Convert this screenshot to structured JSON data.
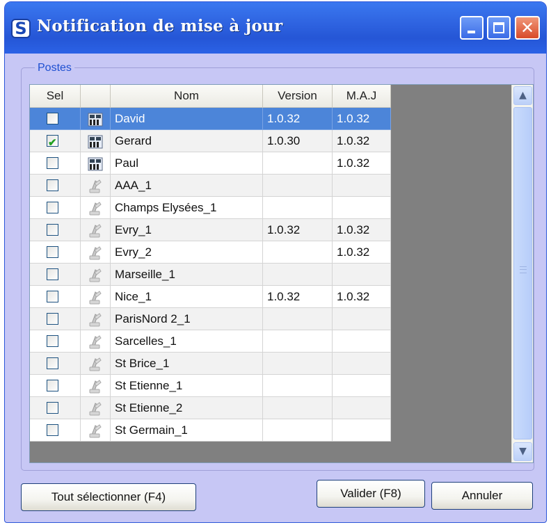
{
  "window": {
    "title": "Notification de mise à jour",
    "app_icon_letter": "S"
  },
  "group": {
    "label": "Postes"
  },
  "grid": {
    "columns": [
      "Sel",
      "",
      "Nom",
      "Version",
      "M.A.J"
    ],
    "rows": [
      {
        "checked": false,
        "icon": "computer-icon",
        "nom": "David",
        "version": "1.0.32",
        "maj": "1.0.32",
        "selected": true
      },
      {
        "checked": true,
        "icon": "computer-icon",
        "nom": "Gerard",
        "version": "1.0.30",
        "maj": "1.0.32",
        "selected": false
      },
      {
        "checked": false,
        "icon": "computer-icon",
        "nom": "Paul",
        "version": "",
        "maj": "1.0.32",
        "selected": false
      },
      {
        "checked": false,
        "icon": "tool-icon",
        "nom": "AAA_1",
        "version": "",
        "maj": "",
        "selected": false
      },
      {
        "checked": false,
        "icon": "tool-icon",
        "nom": "Champs Elysées_1",
        "version": "",
        "maj": "",
        "selected": false
      },
      {
        "checked": false,
        "icon": "tool-icon",
        "nom": "Evry_1",
        "version": "1.0.32",
        "maj": "1.0.32",
        "selected": false
      },
      {
        "checked": false,
        "icon": "tool-icon",
        "nom": "Evry_2",
        "version": "",
        "maj": "1.0.32",
        "selected": false
      },
      {
        "checked": false,
        "icon": "tool-icon",
        "nom": "Marseille_1",
        "version": "",
        "maj": "",
        "selected": false
      },
      {
        "checked": false,
        "icon": "tool-icon",
        "nom": "Nice_1",
        "version": "1.0.32",
        "maj": "1.0.32",
        "selected": false
      },
      {
        "checked": false,
        "icon": "tool-icon",
        "nom": "ParisNord 2_1",
        "version": "",
        "maj": "",
        "selected": false
      },
      {
        "checked": false,
        "icon": "tool-icon",
        "nom": "Sarcelles_1",
        "version": "",
        "maj": "",
        "selected": false
      },
      {
        "checked": false,
        "icon": "tool-icon",
        "nom": "St Brice_1",
        "version": "",
        "maj": "",
        "selected": false
      },
      {
        "checked": false,
        "icon": "tool-icon",
        "nom": "St Etienne_1",
        "version": "",
        "maj": "",
        "selected": false
      },
      {
        "checked": false,
        "icon": "tool-icon",
        "nom": "St Etienne_2",
        "version": "",
        "maj": "",
        "selected": false
      },
      {
        "checked": false,
        "icon": "tool-icon",
        "nom": "St Germain_1",
        "version": "",
        "maj": "",
        "selected": false
      }
    ]
  },
  "buttons": {
    "select_all": "Tout sélectionner (F4)",
    "validate": "Valider (F8)",
    "cancel": "Annuler"
  },
  "colors": {
    "dialog_bg": "#c7c7f5",
    "titlebar": "#2f64e1",
    "selected_row": "#4c85d9",
    "check": "#22a122"
  }
}
